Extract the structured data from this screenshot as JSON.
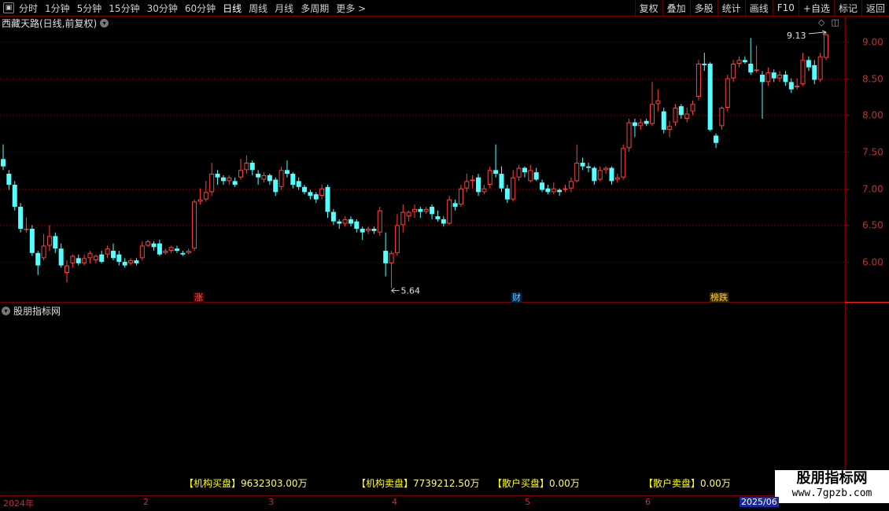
{
  "toolbar": {
    "icon": "window-icon",
    "periods": [
      "分时",
      "1分钟",
      "5分钟",
      "15分钟",
      "30分钟",
      "60分钟",
      "日线",
      "周线",
      "月线",
      "多周期",
      "更多 >"
    ],
    "active_period": "日线",
    "right_buttons": [
      "复权",
      "叠加",
      "多股",
      "统计",
      "画线",
      "F10",
      "+自选",
      "标记",
      "返回"
    ]
  },
  "chart": {
    "title": "西藏天路(日线,前复权)",
    "price_ticks": [
      "9.00",
      "8.50",
      "8.00",
      "7.50",
      "7.00",
      "6.50",
      "6.00"
    ],
    "high_label": "9.13",
    "low_label": "5.64",
    "signals": [
      {
        "text": "涨",
        "color": "#ff5050",
        "bg": "#4a0000"
      },
      {
        "text": "财",
        "color": "#66ccff",
        "bg": "#002244"
      },
      {
        "text": "榜跌",
        "color": "#ffcc33",
        "bg": "#3a2a00"
      }
    ],
    "colors": {
      "up": "#ff4040",
      "down": "#54ffff",
      "grid": "#5a0000",
      "axis": "#7a0000"
    }
  },
  "subchart": {
    "title": "股朋指标网"
  },
  "stats": [
    {
      "label": "【机构买盘】",
      "value": "9632303.00万"
    },
    {
      "label": "【机构卖盘】",
      "value": "7739212.50万"
    },
    {
      "label": "【散户买盘】",
      "value": "0.00万"
    },
    {
      "label": "【散户卖盘】",
      "value": "0.00万"
    }
  ],
  "brand": {
    "name": "股朋指标网",
    "url": "www.7gpzb.com"
  },
  "xaxis": {
    "labels": [
      "2024年",
      "2",
      "3",
      "4",
      "5",
      "6",
      "2025/06"
    ]
  },
  "chart_data": {
    "type": "candlestick",
    "ylim": [
      5.5,
      9.3
    ],
    "candles": [
      [
        7.4,
        7.3,
        7.6,
        7.25
      ],
      [
        7.2,
        7.05,
        7.25,
        6.98
      ],
      [
        7.05,
        6.75,
        7.1,
        6.7
      ],
      [
        6.75,
        6.45,
        6.8,
        6.4
      ],
      [
        6.45,
        6.45,
        6.6,
        6.4
      ],
      [
        6.45,
        6.12,
        6.5,
        6.08
      ],
      [
        6.12,
        5.95,
        6.15,
        5.82
      ],
      [
        6.05,
        6.22,
        6.38,
        6.02
      ],
      [
        6.22,
        6.35,
        6.5,
        6.15
      ],
      [
        6.35,
        6.18,
        6.4,
        6.12
      ],
      [
        6.18,
        5.95,
        6.25,
        5.92
      ],
      [
        5.85,
        5.95,
        6.02,
        5.72
      ],
      [
        5.98,
        6.08,
        6.1,
        5.92
      ],
      [
        6.05,
        5.98,
        6.1,
        5.95
      ],
      [
        5.98,
        6.05,
        6.1,
        5.95
      ],
      [
        6.05,
        6.12,
        6.15,
        5.98
      ],
      [
        6.02,
        6.08,
        6.1,
        5.98
      ],
      [
        6.1,
        6.0,
        6.15,
        5.98
      ],
      [
        6.1,
        6.18,
        6.22,
        6.05
      ],
      [
        6.15,
        6.05,
        6.25,
        6.02
      ],
      [
        6.1,
        6.0,
        6.15,
        5.95
      ],
      [
        6.0,
        5.95,
        6.05,
        5.92
      ],
      [
        5.98,
        6.02,
        6.05,
        5.95
      ],
      [
        6.02,
        5.98,
        6.05,
        5.95
      ],
      [
        6.05,
        6.22,
        6.28,
        6.02
      ],
      [
        6.22,
        6.28,
        6.3,
        6.2
      ],
      [
        6.25,
        6.2,
        6.28,
        6.15
      ],
      [
        6.25,
        6.1,
        6.3,
        6.08
      ],
      [
        6.12,
        6.15,
        6.18,
        6.1
      ],
      [
        6.15,
        6.2,
        6.22,
        6.12
      ],
      [
        6.18,
        6.15,
        6.22,
        6.12
      ],
      [
        6.12,
        6.1,
        6.15,
        6.08
      ],
      [
        6.12,
        6.15,
        6.18,
        6.1
      ],
      [
        6.18,
        6.82,
        6.85,
        6.15
      ],
      [
        6.82,
        6.85,
        7.0,
        6.78
      ],
      [
        6.85,
        6.95,
        7.1,
        6.82
      ],
      [
        6.95,
        7.2,
        7.35,
        6.9
      ],
      [
        7.2,
        7.15,
        7.25,
        7.05
      ],
      [
        7.15,
        7.1,
        7.18,
        7.05
      ],
      [
        7.1,
        7.15,
        7.18,
        7.05
      ],
      [
        7.1,
        7.05,
        7.15,
        7.02
      ],
      [
        7.15,
        7.25,
        7.4,
        7.12
      ],
      [
        7.25,
        7.35,
        7.45,
        7.2
      ],
      [
        7.35,
        7.25,
        7.38,
        7.18
      ],
      [
        7.2,
        7.15,
        7.25,
        7.05
      ],
      [
        7.12,
        7.18,
        7.22,
        7.08
      ],
      [
        7.18,
        7.1,
        7.2,
        7.05
      ],
      [
        7.12,
        6.95,
        7.15,
        6.9
      ],
      [
        7.02,
        7.25,
        7.3,
        6.98
      ],
      [
        7.25,
        7.2,
        7.38,
        7.15
      ],
      [
        7.2,
        7.05,
        7.22,
        7.0
      ],
      [
        7.1,
        7.02,
        7.15,
        6.98
      ],
      [
        7.02,
        6.95,
        7.05,
        6.92
      ],
      [
        6.95,
        6.9,
        6.98,
        6.85
      ],
      [
        6.92,
        6.85,
        6.95,
        6.8
      ],
      [
        6.9,
        7.0,
        7.05,
        6.85
      ],
      [
        7.02,
        6.68,
        7.05,
        6.6
      ],
      [
        6.68,
        6.55,
        6.72,
        6.5
      ],
      [
        6.55,
        6.52,
        6.58,
        6.45
      ],
      [
        6.52,
        6.58,
        6.62,
        6.48
      ],
      [
        6.58,
        6.52,
        6.62,
        6.48
      ],
      [
        6.55,
        6.45,
        6.58,
        6.4
      ],
      [
        6.45,
        6.4,
        6.48,
        6.3
      ],
      [
        6.42,
        6.45,
        6.48,
        6.38
      ],
      [
        6.45,
        6.42,
        6.48,
        6.38
      ],
      [
        6.4,
        6.7,
        6.75,
        6.35
      ],
      [
        6.15,
        5.98,
        6.4,
        5.8
      ],
      [
        5.98,
        6.12,
        6.15,
        5.64
      ],
      [
        6.12,
        6.5,
        6.65,
        6.08
      ],
      [
        6.5,
        6.68,
        6.78,
        6.4
      ],
      [
        6.62,
        6.68,
        6.7,
        6.55
      ],
      [
        6.68,
        6.72,
        6.78,
        6.6
      ],
      [
        6.72,
        6.68,
        6.75,
        6.6
      ],
      [
        6.68,
        6.72,
        6.75,
        6.65
      ],
      [
        6.75,
        6.65,
        6.78,
        6.58
      ],
      [
        6.62,
        6.58,
        6.7,
        6.55
      ],
      [
        6.58,
        6.52,
        6.62,
        6.48
      ],
      [
        6.52,
        6.85,
        6.9,
        6.5
      ],
      [
        6.8,
        6.75,
        6.85,
        6.7
      ],
      [
        6.78,
        7.0,
        7.05,
        6.75
      ],
      [
        7.0,
        7.1,
        7.2,
        6.95
      ],
      [
        7.1,
        7.12,
        7.18,
        7.0
      ],
      [
        7.15,
        6.95,
        7.2,
        6.9
      ],
      [
        6.95,
        7.0,
        7.05,
        6.92
      ],
      [
        7.05,
        7.25,
        7.3,
        7.0
      ],
      [
        7.25,
        7.2,
        7.6,
        7.15
      ],
      [
        7.2,
        7.0,
        7.3,
        6.95
      ],
      [
        7.0,
        6.85,
        7.05,
        6.8
      ],
      [
        6.85,
        7.15,
        7.25,
        6.82
      ],
      [
        7.15,
        7.28,
        7.32,
        7.1
      ],
      [
        7.28,
        7.22,
        7.3,
        7.15
      ],
      [
        7.1,
        7.25,
        7.32,
        7.08
      ],
      [
        7.22,
        7.12,
        7.28,
        7.1
      ],
      [
        7.08,
        6.98,
        7.12,
        6.95
      ],
      [
        7.0,
        6.95,
        7.05,
        6.92
      ],
      [
        6.95,
        7.0,
        7.08,
        6.92
      ],
      [
        6.98,
        6.95,
        7.0,
        6.9
      ],
      [
        6.98,
        7.0,
        7.05,
        6.95
      ],
      [
        7.0,
        7.1,
        7.15,
        6.95
      ],
      [
        7.1,
        7.35,
        7.6,
        7.08
      ],
      [
        7.35,
        7.3,
        7.42,
        7.25
      ],
      [
        7.3,
        7.28,
        7.35,
        7.22
      ],
      [
        7.28,
        7.1,
        7.3,
        7.05
      ],
      [
        7.12,
        7.25,
        7.3,
        7.1
      ],
      [
        7.25,
        7.28,
        7.3,
        7.2
      ],
      [
        7.28,
        7.1,
        7.3,
        7.05
      ],
      [
        7.12,
        7.15,
        7.2,
        7.08
      ],
      [
        7.15,
        7.55,
        7.6,
        7.12
      ],
      [
        7.55,
        7.9,
        7.95,
        7.5
      ],
      [
        7.9,
        7.85,
        7.95,
        7.7
      ],
      [
        7.85,
        7.9,
        7.95,
        7.8
      ],
      [
        7.92,
        7.88,
        7.95,
        7.85
      ],
      [
        7.88,
        8.15,
        8.45,
        7.85
      ],
      [
        8.15,
        8.2,
        8.35,
        8.05
      ],
      [
        8.05,
        7.8,
        8.1,
        7.75
      ],
      [
        7.8,
        7.85,
        7.92,
        7.7
      ],
      [
        7.9,
        8.1,
        8.15,
        7.85
      ],
      [
        8.12,
        8.0,
        8.15,
        7.95
      ],
      [
        7.95,
        8.02,
        8.1,
        7.9
      ],
      [
        8.05,
        8.15,
        8.2,
        8.0
      ],
      [
        8.25,
        8.7,
        8.75,
        8.2
      ],
      [
        8.7,
        8.68,
        8.85,
        8.6
      ],
      [
        8.7,
        7.8,
        8.72,
        7.78
      ],
      [
        7.72,
        7.62,
        7.75,
        7.55
      ],
      [
        7.85,
        8.1,
        8.12,
        7.8
      ],
      [
        8.1,
        8.5,
        8.55,
        8.05
      ],
      [
        8.5,
        8.7,
        8.75,
        8.45
      ],
      [
        8.7,
        8.75,
        8.8,
        8.65
      ],
      [
        8.75,
        8.72,
        8.8,
        8.7
      ],
      [
        8.7,
        8.58,
        9.05,
        8.55
      ],
      [
        8.6,
        8.62,
        8.95,
        8.58
      ],
      [
        8.55,
        8.45,
        8.6,
        7.95
      ],
      [
        8.45,
        8.58,
        8.65,
        8.4
      ],
      [
        8.58,
        8.5,
        8.62,
        8.45
      ],
      [
        8.5,
        8.55,
        8.6,
        8.45
      ],
      [
        8.55,
        8.45,
        8.6,
        8.4
      ],
      [
        8.45,
        8.35,
        8.5,
        8.3
      ],
      [
        8.38,
        8.4,
        8.5,
        8.35
      ],
      [
        8.42,
        8.75,
        8.85,
        8.4
      ],
      [
        8.75,
        8.65,
        8.8,
        8.6
      ],
      [
        8.68,
        8.48,
        8.75,
        8.42
      ],
      [
        8.48,
        8.8,
        8.85,
        8.45
      ],
      [
        8.78,
        9.1,
        9.13,
        8.75
      ]
    ]
  }
}
